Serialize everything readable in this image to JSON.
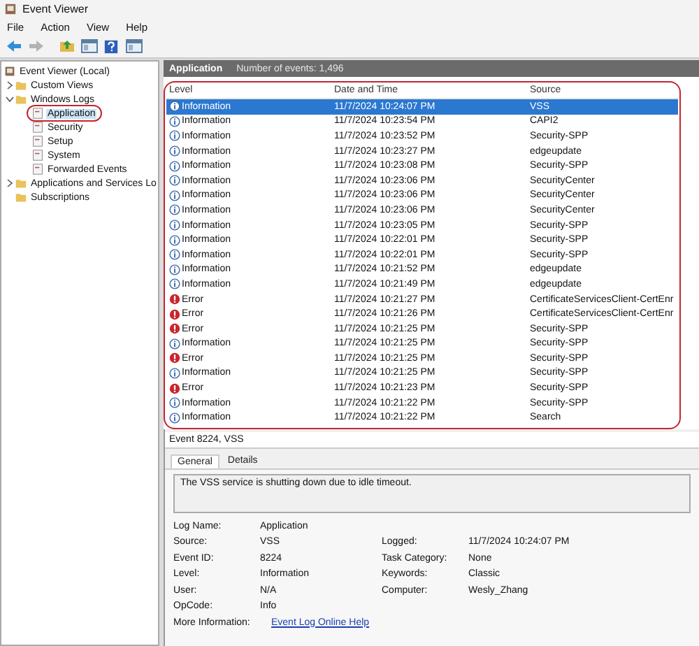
{
  "window": {
    "title": "Event Viewer"
  },
  "menu": [
    "File",
    "Action",
    "View",
    "Help"
  ],
  "toolbar": [
    {
      "kind": "back",
      "disabled": false
    },
    {
      "kind": "forward",
      "disabled": true
    },
    {
      "kind": "folder",
      "disabled": false
    },
    {
      "kind": "pane",
      "disabled": false
    },
    {
      "kind": "help",
      "disabled": false
    },
    {
      "kind": "pane",
      "disabled": false
    }
  ],
  "tree": [
    {
      "label": "Event Viewer (Local)",
      "selected": false,
      "children": [
        {
          "label": "Custom Views",
          "kind": "folder",
          "expanded": false,
          "selected": false
        },
        {
          "label": "Windows Logs",
          "kind": "folder",
          "expanded": true,
          "selected": false,
          "children": [
            {
              "label": "Application",
              "selected": true,
              "circled": true
            },
            {
              "label": "Security",
              "selected": false,
              "circled": false
            },
            {
              "label": "Setup",
              "selected": false,
              "circled": false
            },
            {
              "label": "System",
              "selected": false,
              "circled": false
            },
            {
              "label": "Forwarded Events",
              "selected": false,
              "circled": false
            }
          ]
        },
        {
          "label": "Applications and Services Lo",
          "kind": "folder",
          "expanded": false,
          "selected": false
        },
        {
          "label": "Subscriptions",
          "kind": "leaf",
          "selected": false
        }
      ]
    }
  ],
  "log_header": {
    "title": "Application",
    "count": "Number of events: 1,496"
  },
  "events": {
    "circled": true,
    "columns": [
      "Level",
      "Date and Time",
      "Source"
    ],
    "rows": [
      {
        "level": "Information",
        "kind": "info",
        "time": "11/7/2024 10:24:07 PM",
        "source": "VSS",
        "selected": true
      },
      {
        "level": "Information",
        "kind": "info",
        "time": "11/7/2024 10:23:54 PM",
        "source": "CAPI2",
        "selected": false
      },
      {
        "level": "Information",
        "kind": "info",
        "time": "11/7/2024 10:23:52 PM",
        "source": "Security-SPP",
        "selected": false
      },
      {
        "level": "Information",
        "kind": "info",
        "time": "11/7/2024 10:23:27 PM",
        "source": "edgeupdate",
        "selected": false
      },
      {
        "level": "Information",
        "kind": "info",
        "time": "11/7/2024 10:23:08 PM",
        "source": "Security-SPP",
        "selected": false
      },
      {
        "level": "Information",
        "kind": "info",
        "time": "11/7/2024 10:23:06 PM",
        "source": "SecurityCenter",
        "selected": false
      },
      {
        "level": "Information",
        "kind": "info",
        "time": "11/7/2024 10:23:06 PM",
        "source": "SecurityCenter",
        "selected": false
      },
      {
        "level": "Information",
        "kind": "info",
        "time": "11/7/2024 10:23:06 PM",
        "source": "SecurityCenter",
        "selected": false
      },
      {
        "level": "Information",
        "kind": "info",
        "time": "11/7/2024 10:23:05 PM",
        "source": "Security-SPP",
        "selected": false
      },
      {
        "level": "Information",
        "kind": "info",
        "time": "11/7/2024 10:22:01 PM",
        "source": "Security-SPP",
        "selected": false
      },
      {
        "level": "Information",
        "kind": "info",
        "time": "11/7/2024 10:22:01 PM",
        "source": "Security-SPP",
        "selected": false
      },
      {
        "level": "Information",
        "kind": "info",
        "time": "11/7/2024 10:21:52 PM",
        "source": "edgeupdate",
        "selected": false
      },
      {
        "level": "Information",
        "kind": "info",
        "time": "11/7/2024 10:21:49 PM",
        "source": "edgeupdate",
        "selected": false
      },
      {
        "level": "Error",
        "kind": "error",
        "time": "11/7/2024 10:21:27 PM",
        "source": "CertificateServicesClient-CertEnr",
        "selected": false
      },
      {
        "level": "Error",
        "kind": "error",
        "time": "11/7/2024 10:21:26 PM",
        "source": "CertificateServicesClient-CertEnr",
        "selected": false
      },
      {
        "level": "Error",
        "kind": "error",
        "time": "11/7/2024 10:21:25 PM",
        "source": "Security-SPP",
        "selected": false
      },
      {
        "level": "Information",
        "kind": "info",
        "time": "11/7/2024 10:21:25 PM",
        "source": "Security-SPP",
        "selected": false
      },
      {
        "level": "Error",
        "kind": "error",
        "time": "11/7/2024 10:21:25 PM",
        "source": "Security-SPP",
        "selected": false
      },
      {
        "level": "Information",
        "kind": "info",
        "time": "11/7/2024 10:21:25 PM",
        "source": "Security-SPP",
        "selected": false
      },
      {
        "level": "Error",
        "kind": "error",
        "time": "11/7/2024 10:21:23 PM",
        "source": "Security-SPP",
        "selected": false
      },
      {
        "level": "Information",
        "kind": "info",
        "time": "11/7/2024 10:21:22 PM",
        "source": "Security-SPP",
        "selected": false
      },
      {
        "level": "Information",
        "kind": "info",
        "time": "11/7/2024 10:21:22 PM",
        "source": "Search",
        "selected": false
      }
    ]
  },
  "detail": {
    "title": "Event 8224, VSS",
    "tabs": [
      {
        "label": "General",
        "selected": true
      },
      {
        "label": "Details",
        "selected": false
      }
    ],
    "message": "The VSS service is shutting down due to idle timeout.",
    "properties": [
      [
        {
          "label": "Log Name:",
          "value": "Application"
        }
      ],
      [
        {
          "label": "Source:",
          "value": "VSS"
        },
        {
          "label": "Logged:",
          "value": "11/7/2024 10:24:07 PM"
        }
      ],
      [
        {
          "label": "Event ID:",
          "value": "8224"
        },
        {
          "label": "Task Category:",
          "value": "None"
        }
      ],
      [
        {
          "label": "Level:",
          "value": "Information"
        },
        {
          "label": "Keywords:",
          "value": "Classic"
        }
      ],
      [
        {
          "label": "User:",
          "value": "N/A"
        },
        {
          "label": "Computer:",
          "value": "Wesly_Zhang"
        }
      ],
      [
        {
          "label": "OpCode:",
          "value": "Info"
        }
      ],
      [
        {
          "label": "More Information:",
          "value": "Event Log Online Help",
          "kind": "link"
        }
      ]
    ]
  }
}
